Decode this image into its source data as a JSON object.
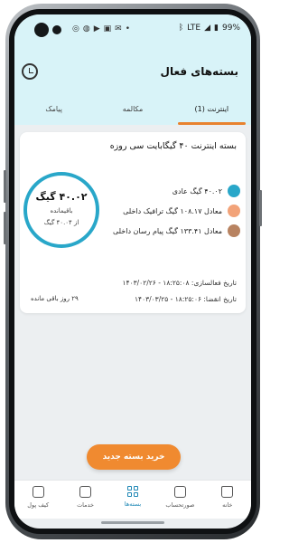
{
  "status": {
    "lte": "LTE",
    "battery": "99%"
  },
  "header": {
    "title": "بسته‌های فعال"
  },
  "tabs": [
    {
      "label": "اینترنت (1)",
      "active": true
    },
    {
      "label": "مکالمه",
      "active": false
    },
    {
      "label": "پیامک",
      "active": false
    }
  ],
  "package": {
    "title": "بسته اینترنت ۴۰ گیگابایت سی روزه",
    "remaining_value": "۴۰.۰۲ گیگ",
    "remaining_label": "باقیمانده",
    "total_label": "از ۴۰.۰۴ گیگ",
    "legend": [
      {
        "label": "۴۰.۰۲ گیگ عادی",
        "color": "#29a7c9"
      },
      {
        "label": "معادل ۱۰۸.۱۷ گیگ ترافیک داخلی",
        "color": "#f2a379"
      },
      {
        "label": "معادل ۱۳۳.۴۱ گیگ پیام رسان داخلی",
        "color": "#b88361"
      }
    ],
    "activation_date": "تاریخ فعالسازی: ۱۸:۲۵:۰۸ - ۱۴۰۳/۰۲/۲۶",
    "expiry_date": "تاریخ انقضا: ۱۸:۲۵:۰۶ - ۱۴۰۳/۰۳/۲۵",
    "days_left": "۲۹ روز باقی مانده"
  },
  "buy_button": "خرید بسته جدید",
  "bottom_nav": [
    {
      "label": "خانه",
      "icon": "home-icon",
      "active": false
    },
    {
      "label": "صورتحساب",
      "icon": "bill-icon",
      "active": false
    },
    {
      "label": "بسته‌ها",
      "icon": "packages-icon",
      "active": true
    },
    {
      "label": "خدمات",
      "icon": "services-icon",
      "active": false
    },
    {
      "label": "کیف پول",
      "icon": "wallet-icon",
      "active": false
    }
  ]
}
